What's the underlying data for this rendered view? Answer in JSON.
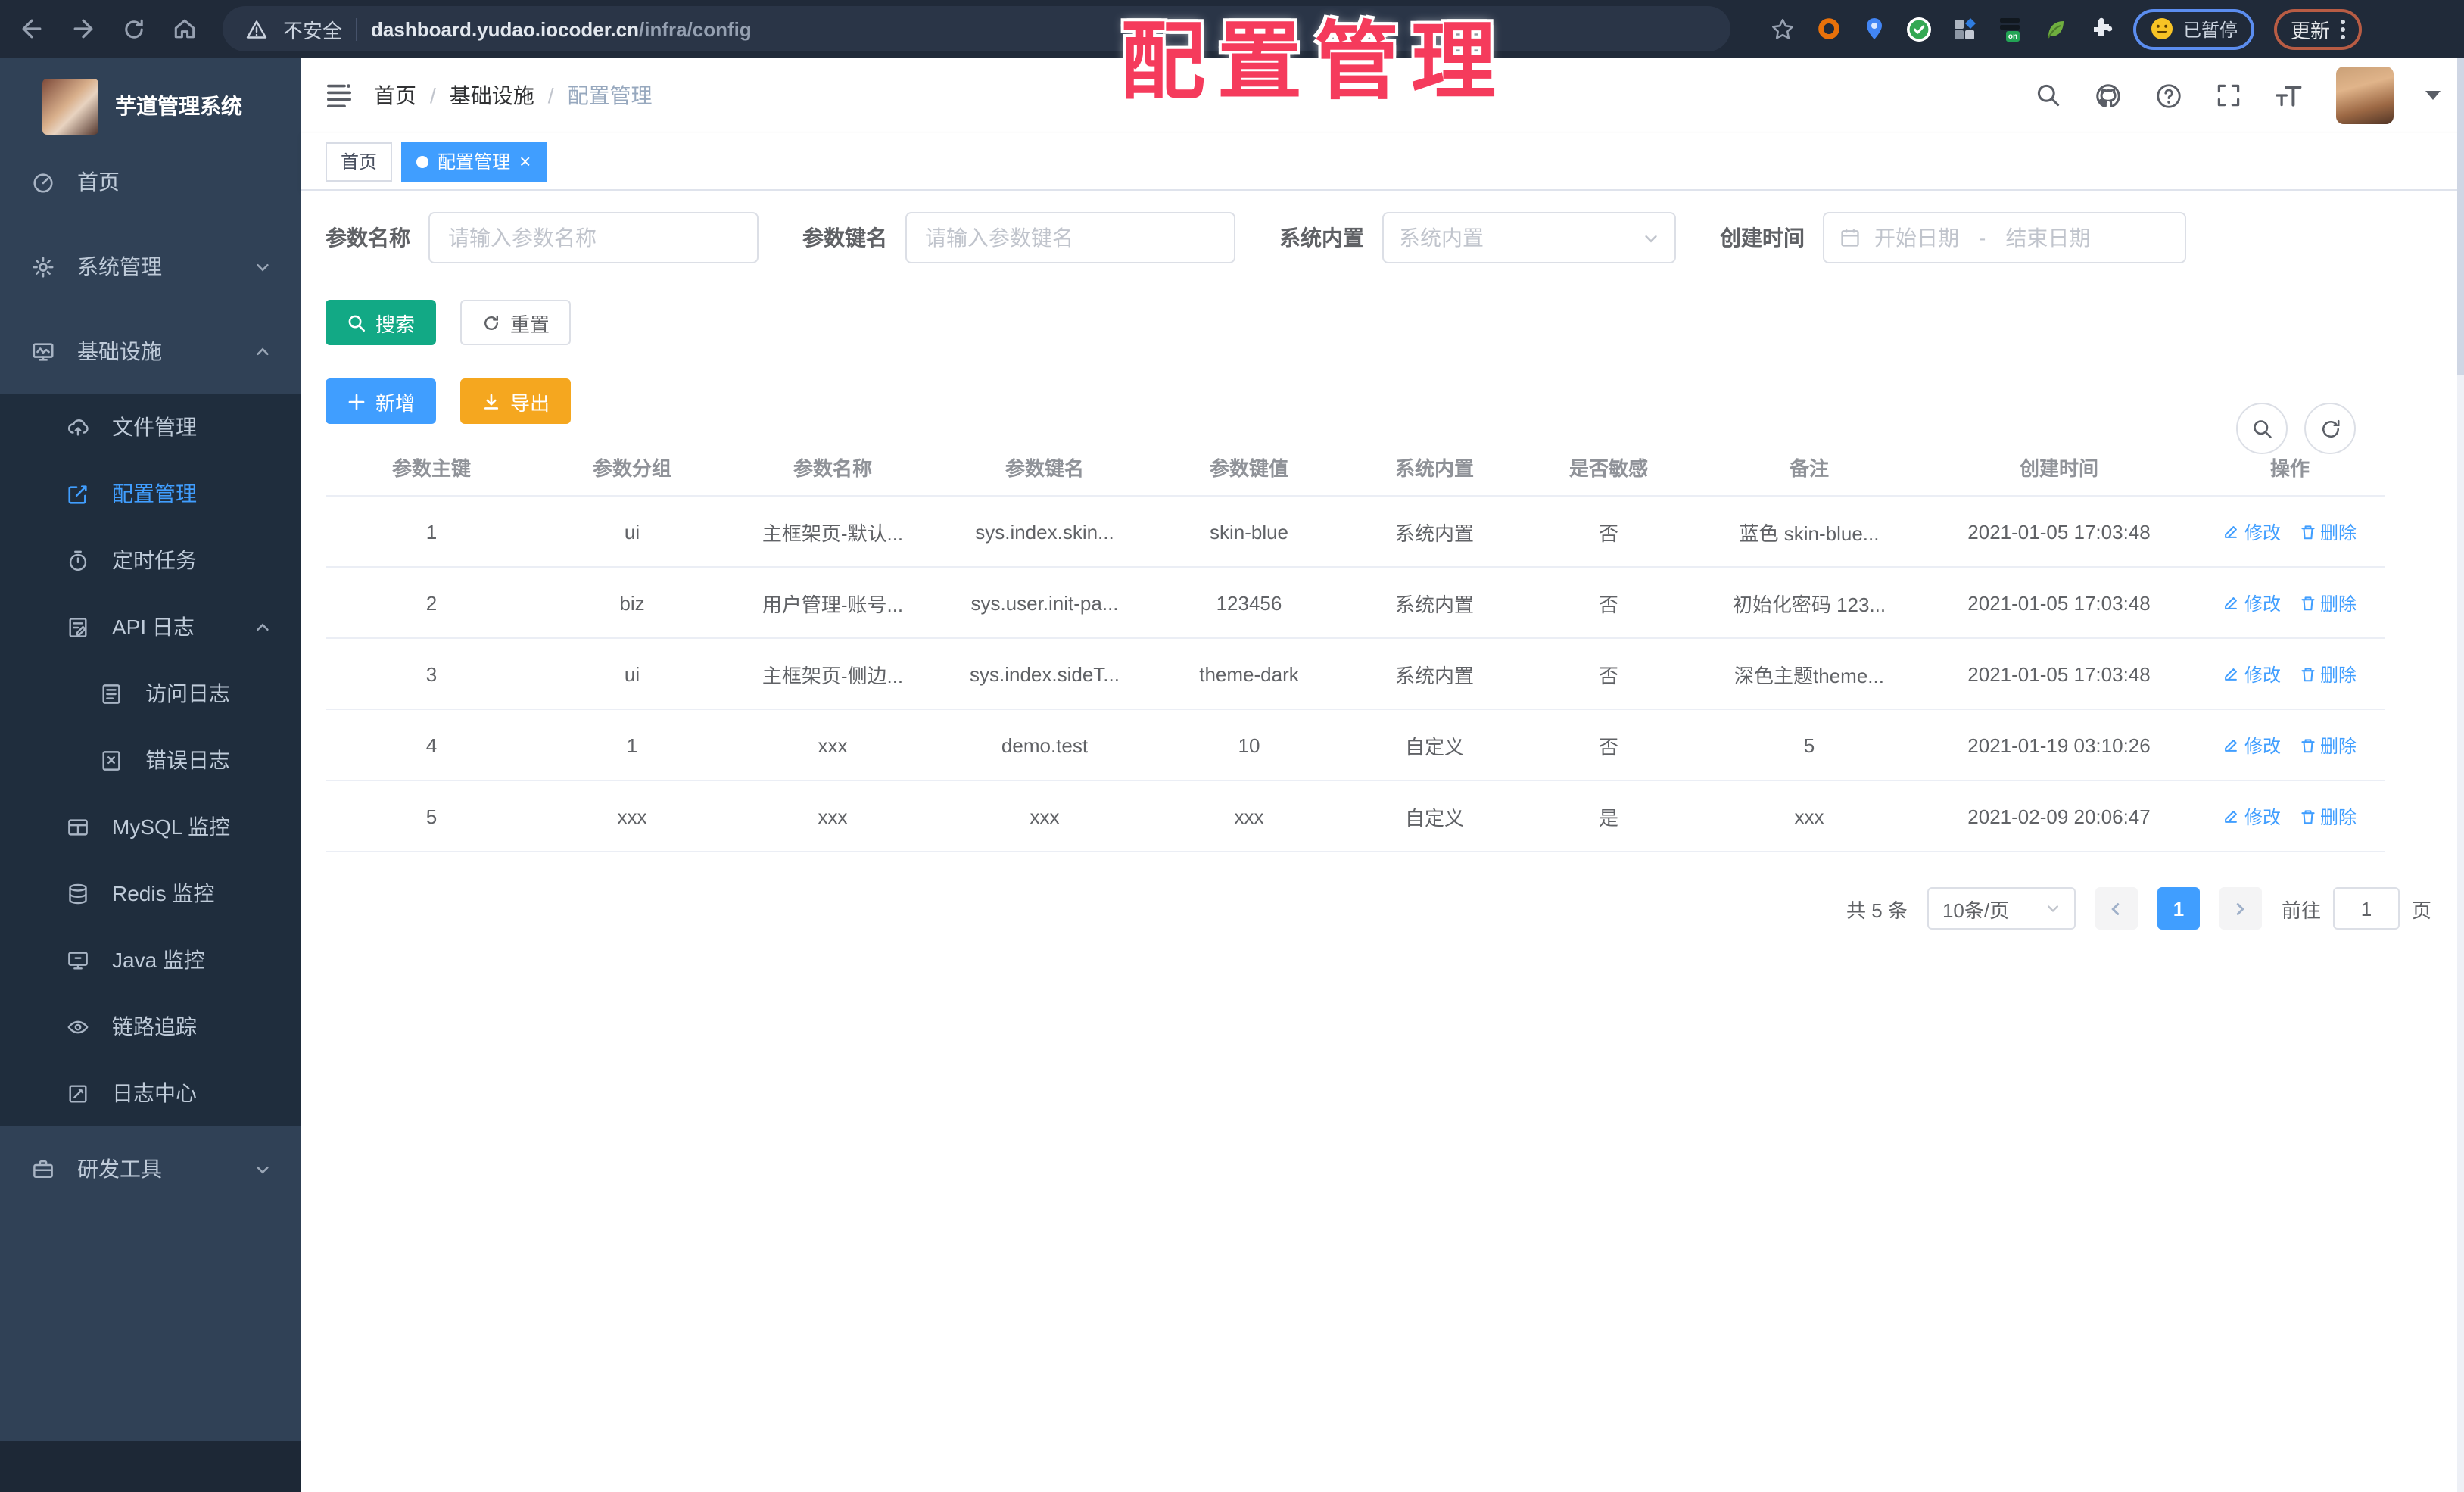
{
  "browser": {
    "security_label": "不安全",
    "url_host": "dashboard.yudao.iocoder.cn",
    "url_path": "/infra/config",
    "paused_label": "已暂停",
    "update_label": "更新"
  },
  "overlay": {
    "title": "配置管理",
    "color": "#f53b5c"
  },
  "app": {
    "logo_title": "芋道管理系统",
    "breadcrumb": {
      "home": "首页",
      "section": "基础设施",
      "current": "配置管理"
    },
    "tabs": [
      {
        "label": "首页"
      },
      {
        "label": "配置管理"
      }
    ]
  },
  "sidebar": {
    "items": [
      {
        "label": "首页"
      },
      {
        "label": "系统管理"
      },
      {
        "label": "基础设施"
      },
      {
        "label": "文件管理"
      },
      {
        "label": "配置管理"
      },
      {
        "label": "定时任务"
      },
      {
        "label": "API 日志"
      },
      {
        "label": "访问日志"
      },
      {
        "label": "错误日志"
      },
      {
        "label": "MySQL 监控"
      },
      {
        "label": "Redis 监控"
      },
      {
        "label": "Java 监控"
      },
      {
        "label": "链路追踪"
      },
      {
        "label": "日志中心"
      },
      {
        "label": "研发工具"
      }
    ]
  },
  "filters": {
    "name_label": "参数名称",
    "name_placeholder": "请输入参数名称",
    "key_label": "参数键名",
    "key_placeholder": "请输入参数键名",
    "type_label": "系统内置",
    "type_placeholder": "系统内置",
    "time_label": "创建时间",
    "start_placeholder": "开始日期",
    "range_separator": "-",
    "end_placeholder": "结束日期"
  },
  "actions": {
    "search": "搜索",
    "reset": "重置",
    "add": "新增",
    "export": "导出"
  },
  "table": {
    "headers": [
      "参数主键",
      "参数分组",
      "参数名称",
      "参数键名",
      "参数键值",
      "系统内置",
      "是否敏感",
      "备注",
      "创建时间",
      "操作"
    ],
    "action_labels": {
      "edit": "修改",
      "delete": "删除"
    },
    "rows": [
      {
        "id": "1",
        "group": "ui",
        "name": "主框架页-默认...",
        "key": "sys.index.skin...",
        "value": "skin-blue",
        "type": "系统内置",
        "sensitive": "否",
        "remark": "蓝色 skin-blue...",
        "created": "2021-01-05 17:03:48"
      },
      {
        "id": "2",
        "group": "biz",
        "name": "用户管理-账号...",
        "key": "sys.user.init-pa...",
        "value": "123456",
        "type": "系统内置",
        "sensitive": "否",
        "remark": "初始化密码 123...",
        "created": "2021-01-05 17:03:48"
      },
      {
        "id": "3",
        "group": "ui",
        "name": "主框架页-侧边...",
        "key": "sys.index.sideT...",
        "value": "theme-dark",
        "type": "系统内置",
        "sensitive": "否",
        "remark": "深色主题theme...",
        "created": "2021-01-05 17:03:48"
      },
      {
        "id": "4",
        "group": "1",
        "name": "xxx",
        "key": "demo.test",
        "value": "10",
        "type": "自定义",
        "sensitive": "否",
        "remark": "5",
        "created": "2021-01-19 03:10:26"
      },
      {
        "id": "5",
        "group": "xxx",
        "name": "xxx",
        "key": "xxx",
        "value": "xxx",
        "type": "自定义",
        "sensitive": "是",
        "remark": "xxx",
        "created": "2021-02-09 20:06:47"
      }
    ]
  },
  "pagination": {
    "total": "共 5 条",
    "page_size": "10条/页",
    "current": "1",
    "goto_label": "前往",
    "goto_value": "1",
    "page_label": "页"
  },
  "icons": {
    "search": "magnifier",
    "github": "octocat",
    "docs": "question-circle",
    "fullscreen": "expand-corners",
    "font_size": "tT",
    "refresh": "circular-arrows",
    "toggle_search": "magnifier-circle",
    "edit_action": "pencil",
    "delete_action": "trash",
    "calendar": "calendar",
    "warning": "triangle-exclamation"
  },
  "colors": {
    "accent": "#409eff",
    "success": "#12a985",
    "warning": "#f5a71f",
    "sidebar": "#304156",
    "submenu": "#1f2d3d",
    "annotation": "#f53b5c"
  }
}
